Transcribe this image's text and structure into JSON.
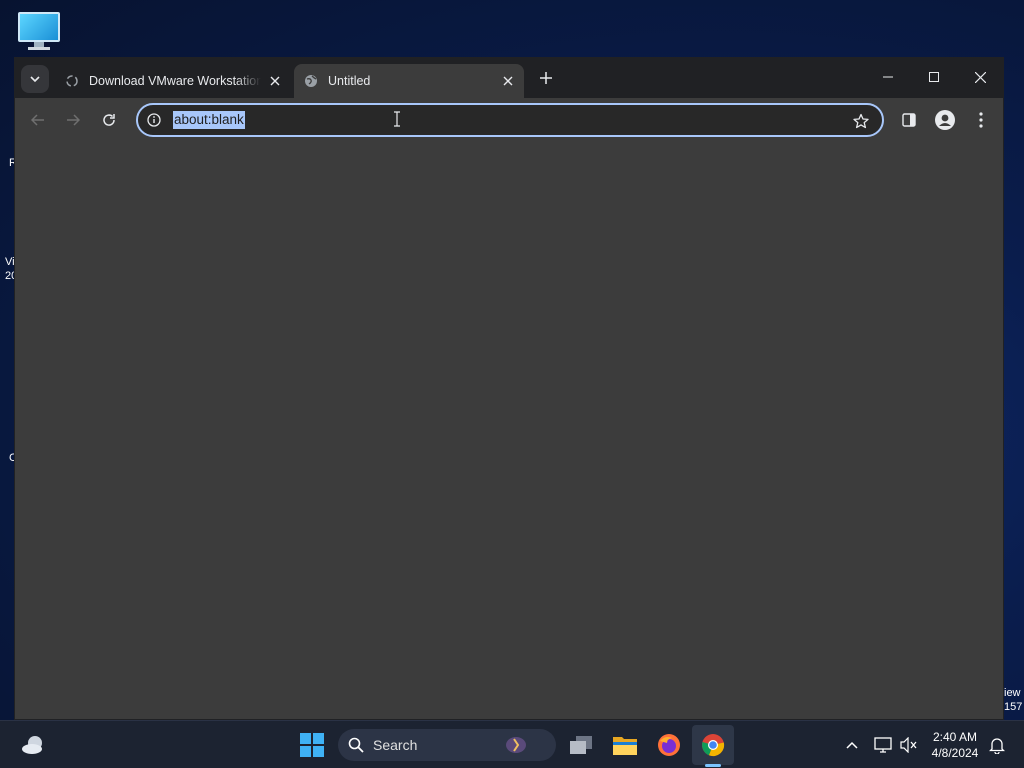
{
  "desktop": {
    "partial_labels": [
      {
        "text": "R"
      },
      {
        "text": "Vi"
      },
      {
        "text": "20"
      },
      {
        "text": "C"
      },
      {
        "text": "iew"
      },
      {
        "text": "157"
      }
    ]
  },
  "browser": {
    "tabs": [
      {
        "title": "Download VMware Workstation",
        "active": false,
        "icon": "vmware-favicon-icon"
      },
      {
        "title": "Untitled",
        "active": true,
        "icon": "globe-icon"
      }
    ],
    "omnibox": {
      "url": "about:blank",
      "selected": true
    },
    "toolbar": {
      "back_enabled": false,
      "forward_enabled": false
    }
  },
  "taskbar": {
    "search_label": "Search",
    "pinned": [
      {
        "name": "task-view",
        "icon": "task-view-icon"
      },
      {
        "name": "file-explorer",
        "icon": "folder-icon"
      },
      {
        "name": "firefox",
        "icon": "firefox-icon"
      },
      {
        "name": "chrome",
        "icon": "chrome-icon",
        "active": true
      }
    ],
    "clock": {
      "time": "2:40 AM",
      "date": "4/8/2024"
    }
  },
  "colors": {
    "accent": "#a8c7fa",
    "window_bg": "#3c3c3c",
    "tabstrip_bg": "#202124",
    "taskbar_bg": "#1c2331"
  }
}
